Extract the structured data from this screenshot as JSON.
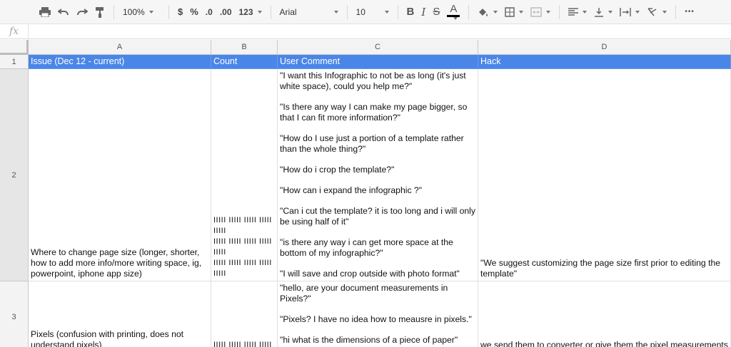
{
  "toolbar": {
    "zoom": "100%",
    "currency": "$",
    "percent": "%",
    "decrease_decimal": ".0",
    "increase_decimal": ".00",
    "more_formats": "123",
    "font_name": "Arial",
    "font_size": "10",
    "bold": "B",
    "italic": "I",
    "strike": "S",
    "text_color_letter": "A",
    "more": "•••"
  },
  "formula_bar": {
    "fx_label": "fx",
    "value": ""
  },
  "columns": [
    "A",
    "B",
    "C",
    "D"
  ],
  "rows": [
    "1",
    "2",
    "3"
  ],
  "header_row": {
    "a": "Issue (Dec 12 -  current)",
    "b": "Count",
    "c": "User Comment",
    "d": "Hack"
  },
  "row2": {
    "a_lines": [
      "Where to change page size (longer, shorter,",
      "how to add more info/more writing space, ig,",
      "powerpoint, iphone app size)"
    ],
    "b_lines": [
      "IIIII IIIII IIIII IIIII IIIII",
      "IIIII IIIII IIIII IIIII IIIII",
      "IIIII IIIII IIIII IIIII IIIII"
    ],
    "c_comments": [
      [
        "\"I want this Infographic to not be as long (it's just",
        "white space), could you help me?\""
      ],
      [
        "\"Is there any way I can make my page bigger, so",
        "that I can fit more information?\""
      ],
      [
        "\"How do I use just a portion of a template rather",
        "than the whole thing?\""
      ],
      [
        "\"How do i crop the template?\""
      ],
      [
        "\"How can i expand the infographic ?\""
      ],
      [
        "\"Can i cut the template? it is too long and i will only",
        "be using half of it\""
      ],
      [
        "\"is there any way i can get more space at the",
        "bottom of my infographic?\""
      ],
      [
        "\"I will save and crop outside with photo format\""
      ]
    ],
    "d_lines": [
      "\"We suggest customizing the page size first prior to editing the",
      "template\""
    ]
  },
  "row3": {
    "a_lines": [
      "Pixels (confusion with printing, does not",
      "understand pixels)"
    ],
    "b_lines": [
      "IIIII IIIII IIIII IIIII"
    ],
    "c_comments": [
      [
        "\"hello, are your document measurements in",
        "Pixels?\""
      ],
      [
        "\"Pixels? I have no idea how to meausre in pixels.\""
      ],
      [
        "\"hi what is the dimensions of a piece of paper\""
      ]
    ],
    "d_lines": [
      "we send them to converter or give them the pixel measurements"
    ]
  },
  "colors": {
    "header_fill": "#4a86e8",
    "header_text": "#ffffff",
    "toolbar_bg": "#f6f6f6",
    "grid_header_bg": "#f3f3f3"
  }
}
